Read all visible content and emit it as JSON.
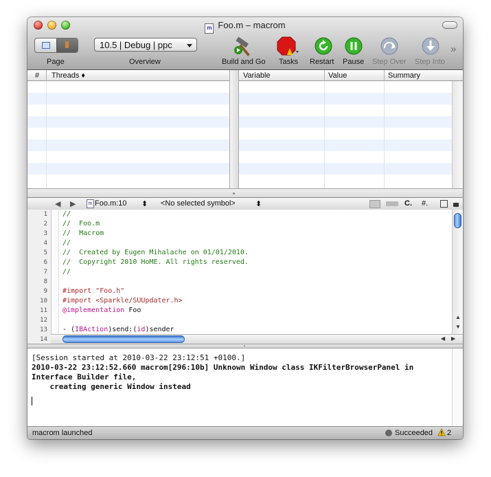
{
  "window": {
    "title": "Foo.m – macrom",
    "doc_badge": "m"
  },
  "toolbar": {
    "page_label": "Page",
    "overview_label": "Overview",
    "overview_value": "10.5 | Debug | ppc",
    "build_and_go_label": "Build and Go",
    "tasks_label": "Tasks",
    "restart_label": "Restart",
    "pause_label": "Pause",
    "step_over_label": "Step Over",
    "step_into_label": "Step Into",
    "overflow_glyph": "»"
  },
  "threads_table": {
    "col_index": "#",
    "col_threads": "Threads ♦"
  },
  "variables_table": {
    "col_variable": "Variable",
    "col_value": "Value",
    "col_summary": "Summary"
  },
  "navbar": {
    "back": "◀",
    "forward": "▶",
    "file": "Foo.m:10",
    "file_arrows": "⬍",
    "symbol": "<No selected symbol>",
    "symbol_arrows": "⬍",
    "lang": "C.",
    "hash": "#."
  },
  "editor": {
    "lines": [
      {
        "n": "1",
        "parts": [
          {
            "t": "//",
            "c": "com"
          }
        ]
      },
      {
        "n": "2",
        "parts": [
          {
            "t": "//  Foo.m",
            "c": "com"
          }
        ]
      },
      {
        "n": "3",
        "parts": [
          {
            "t": "//  Macrom",
            "c": "com"
          }
        ]
      },
      {
        "n": "4",
        "parts": [
          {
            "t": "//",
            "c": "com"
          }
        ]
      },
      {
        "n": "5",
        "parts": [
          {
            "t": "//  Created by Eugen Mihalache on 01/01/2010.",
            "c": "com"
          }
        ]
      },
      {
        "n": "6",
        "parts": [
          {
            "t": "//  Copyright 2010 HoME. All rights reserved.",
            "c": "com"
          }
        ]
      },
      {
        "n": "7",
        "parts": [
          {
            "t": "//",
            "c": "com"
          }
        ]
      },
      {
        "n": "8",
        "parts": []
      },
      {
        "n": "9",
        "parts": [
          {
            "t": "#import ",
            "c": "str"
          },
          {
            "t": "\"Foo.h\"",
            "c": "str"
          }
        ]
      },
      {
        "n": "10",
        "parts": [
          {
            "t": "#import ",
            "c": "str"
          },
          {
            "t": "<Sparkle/SUUpdater.h>",
            "c": "ang"
          }
        ]
      },
      {
        "n": "11",
        "parts": [
          {
            "t": "@implementation",
            "c": "key"
          },
          {
            "t": " Foo",
            "c": "plain"
          }
        ]
      },
      {
        "n": "12",
        "parts": []
      },
      {
        "n": "13",
        "parts": [
          {
            "t": "- (",
            "c": "plain"
          },
          {
            "t": "IBAction",
            "c": "key"
          },
          {
            "t": ")send:(",
            "c": "plain"
          },
          {
            "t": "id",
            "c": "key"
          },
          {
            "t": ")sender",
            "c": "plain"
          }
        ]
      },
      {
        "n": "14",
        "parts": []
      }
    ]
  },
  "console": {
    "lines": [
      {
        "t": "[Session started at 2010-03-22 23:12:51 +0100.]",
        "bold": false
      },
      {
        "t": "2010-03-22 23:12:52.660 macrom[296:10b] Unknown Window class IKFilterBrowserPanel in",
        "bold": true
      },
      {
        "t": "Interface Builder file,",
        "bold": true
      },
      {
        "t": "    creating generic Window instead",
        "bold": true
      }
    ]
  },
  "status": {
    "left": "macrom launched",
    "build_result": "Succeeded",
    "warning_count": "2"
  }
}
